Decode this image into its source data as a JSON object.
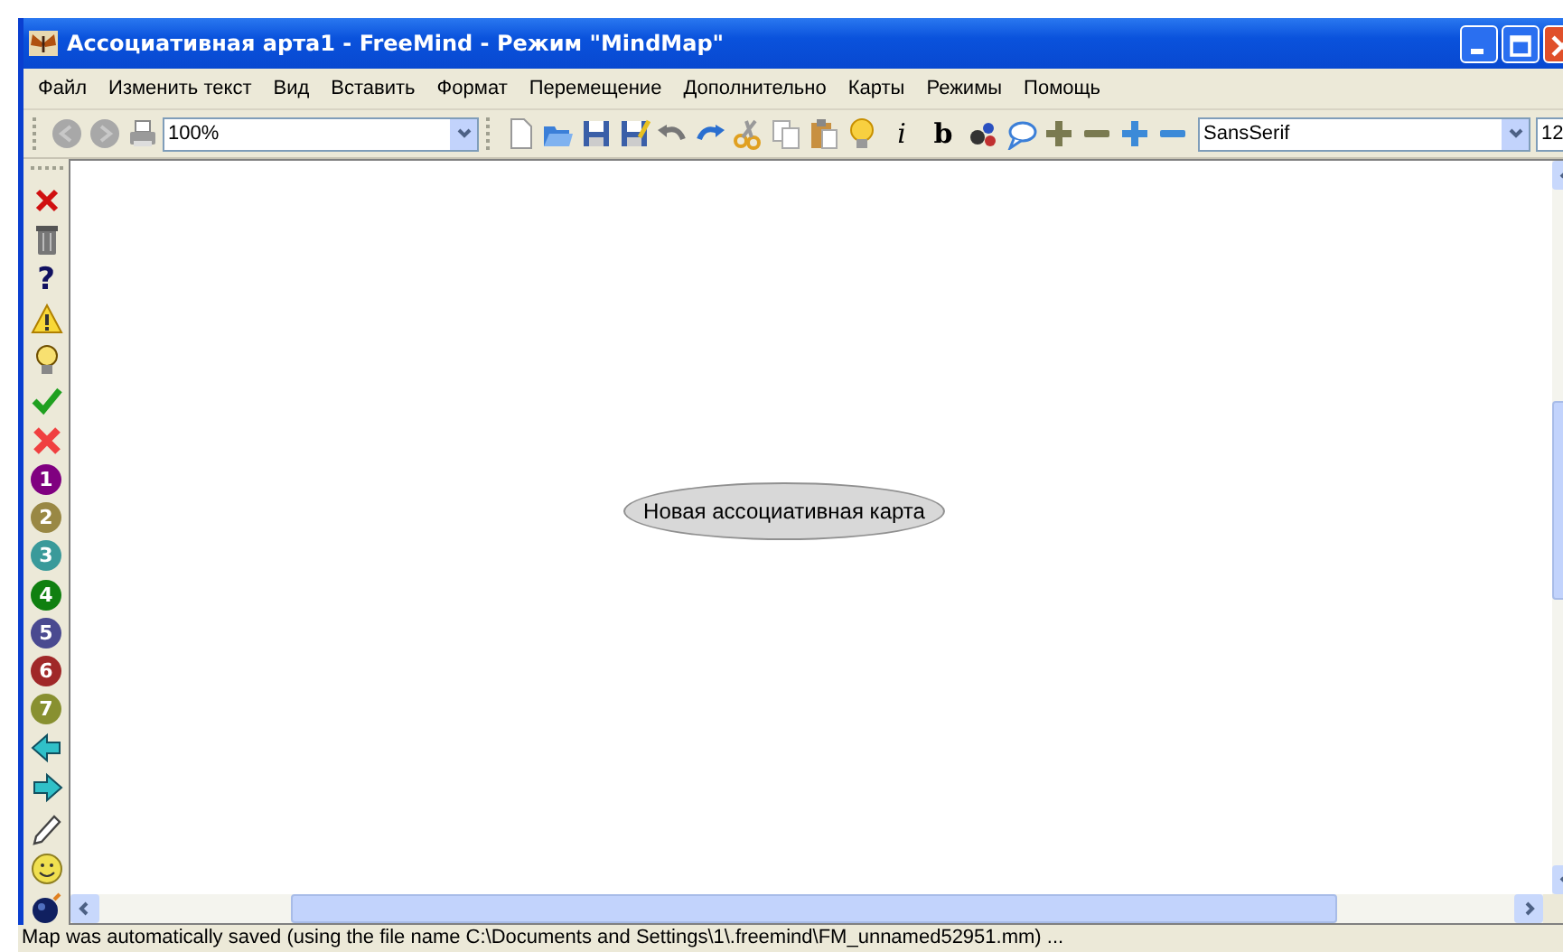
{
  "window": {
    "title": "Ассоциативная арта1 - FreeMind - Режим \"MindMap\""
  },
  "menu": [
    "Файл",
    "Изменить текст",
    "Вид",
    "Вставить",
    "Формат",
    "Перемещение",
    "Дополнительно",
    "Карты",
    "Режимы",
    "Помощь"
  ],
  "toolbar": [
    {
      "kind": "back"
    },
    {
      "kind": "forward"
    },
    {
      "kind": "print"
    },
    {
      "kind": "combo",
      "value": "100%"
    },
    {
      "kind": "new"
    },
    {
      "kind": "open"
    },
    {
      "kind": "save"
    },
    {
      "kind": "saveas"
    },
    {
      "kind": "undo"
    },
    {
      "kind": "redo"
    },
    {
      "kind": "cut"
    },
    {
      "kind": "copy"
    },
    {
      "kind": "paste"
    },
    {
      "kind": "idea"
    },
    {
      "kind": "italic",
      "label": "i"
    },
    {
      "kind": "bold",
      "label": "b"
    },
    {
      "kind": "cloud"
    },
    {
      "kind": "bubble"
    },
    {
      "kind": "plus"
    },
    {
      "kind": "minus"
    },
    {
      "kind": "plus-alt"
    },
    {
      "kind": "minus-alt"
    },
    {
      "kind": "font",
      "value": "SansSerif"
    },
    {
      "kind": "size",
      "value": "12"
    }
  ],
  "icons": [
    {
      "kind": "delete"
    },
    {
      "kind": "trash"
    },
    {
      "kind": "glyph",
      "label": "?"
    },
    {
      "kind": "warning"
    },
    {
      "kind": "idea"
    },
    {
      "kind": "check"
    },
    {
      "kind": "cross"
    },
    {
      "kind": "number",
      "label": "1",
      "color": "#800080"
    },
    {
      "kind": "number",
      "label": "2",
      "color": "#998844"
    },
    {
      "kind": "number",
      "label": "3",
      "color": "#3a9a9a"
    },
    {
      "kind": "number",
      "label": "4",
      "color": "#108010"
    },
    {
      "kind": "number",
      "label": "5",
      "color": "#4a4a90"
    },
    {
      "kind": "number",
      "label": "6",
      "color": "#a02828"
    },
    {
      "kind": "number",
      "label": "7",
      "color": "#889030"
    },
    {
      "kind": "back"
    },
    {
      "kind": "forward"
    },
    {
      "kind": "pencil"
    },
    {
      "kind": "smiley"
    },
    {
      "kind": "bomb"
    }
  ],
  "map": {
    "root_node": "Новая ассоциативная карта"
  },
  "status_bar": "Map was automatically saved (using the file name C:\\Documents and Settings\\1\\.freemind\\FM_unnamed52951.mm) ..."
}
